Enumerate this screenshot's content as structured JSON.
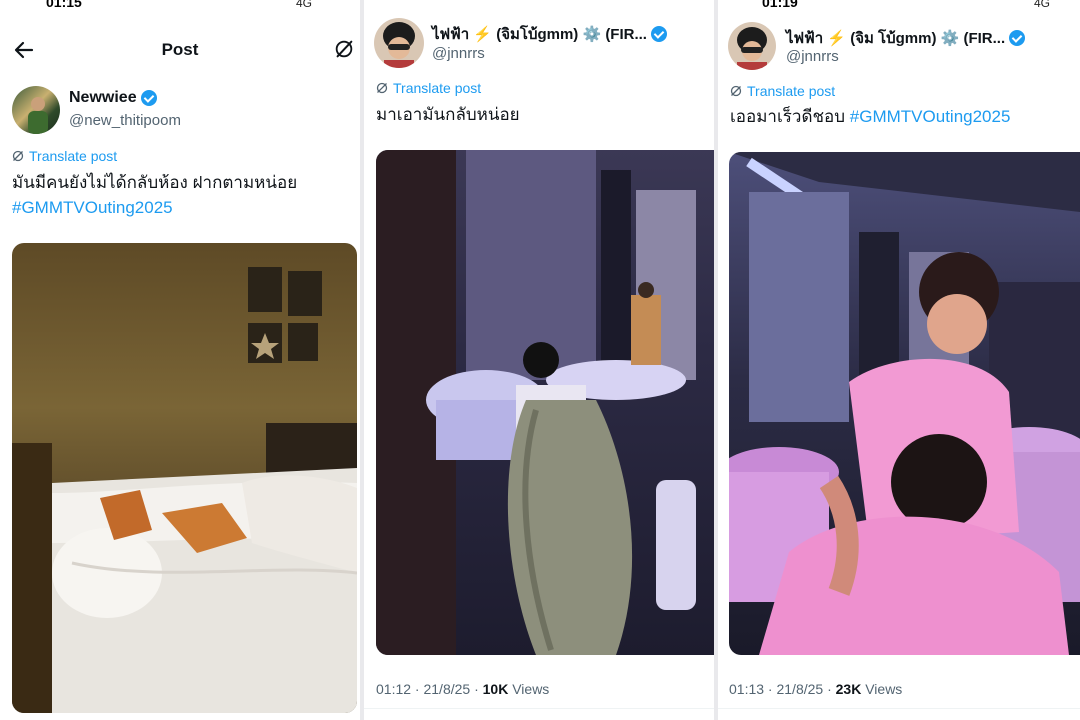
{
  "panel1": {
    "status_time": "01:15",
    "status_right": "4G",
    "header_title": "Post",
    "author": {
      "name": "Newwiee",
      "handle": "@new_thitipoom"
    },
    "translate_label": "Translate post",
    "text_line1": "มันมีคนยังไม่ได้กลับห้อง ฝากตามหน่อย",
    "hashtag": "#GMMTVOuting2025"
  },
  "panel2": {
    "author": {
      "name": "ไฟฟ้า ⚡ (จิมโบ้gmm) ⚙️ (FIR...",
      "handle": "@jnnrrs"
    },
    "translate_label": "Translate post",
    "text": "มาเอามันกลับหน่อย",
    "meta_time": "01:12 · 21/8/25 · ",
    "meta_views_count": "10K",
    "meta_views_label": " Views"
  },
  "panel3": {
    "status_time": "01:19",
    "status_right": "4G",
    "author": {
      "name": "ไฟฟ้า ⚡ (จิม โบ้gmm) ⚙️ (FIR...",
      "handle": "@jnnrrs"
    },
    "translate_label": "Translate post",
    "text": "เออมาเร็วดีชอบ",
    "hashtag": "#GMMTVOuting2025",
    "meta_time": "01:13 · 21/8/25 · ",
    "meta_views_count": "23K",
    "meta_views_label": " Views"
  },
  "icons": {
    "back": "arrow-left-icon",
    "grok": "grok-icon",
    "verified": "verified-badge-icon",
    "translate": "translate-icon"
  },
  "colors": {
    "link": "#1d9bf0",
    "secondary": "#536471",
    "text": "#0f1419"
  }
}
